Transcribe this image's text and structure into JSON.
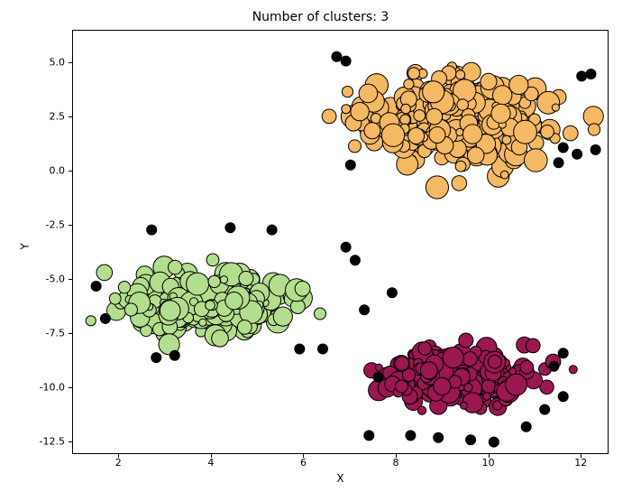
{
  "chart_data": {
    "type": "scatter",
    "title": "Number of clusters: 3",
    "xlabel": "X",
    "ylabel": "Y",
    "xlim": [
      1.0,
      12.6
    ],
    "ylim": [
      -13.1,
      6.5
    ],
    "xticks": [
      2,
      4,
      6,
      8,
      10,
      12
    ],
    "yticks": [
      -12.5,
      -10.0,
      -7.5,
      -5.0,
      -2.5,
      0.0,
      2.5,
      5.0
    ],
    "n_clusters": 3,
    "clusters": [
      {
        "name": "cluster-0",
        "color": "#b3de8e",
        "edge": "#000000",
        "center": [
          4.0,
          -6.0
        ],
        "spread": [
          1.7,
          1.3
        ],
        "n": 260,
        "size_range": [
          4,
          13
        ]
      },
      {
        "name": "cluster-1",
        "color": "#f5b863",
        "edge": "#000000",
        "center": [
          9.3,
          2.3
        ],
        "spread": [
          2.0,
          2.0
        ],
        "n": 340,
        "size_range": [
          4,
          13
        ]
      },
      {
        "name": "cluster-2",
        "color": "#9a1750",
        "edge": "#000000",
        "center": [
          9.3,
          -9.6
        ],
        "spread": [
          1.6,
          1.2
        ],
        "n": 260,
        "size_range": [
          4,
          12
        ]
      }
    ],
    "outliers": {
      "color": "#000000",
      "radius": 6,
      "points": [
        [
          1.5,
          -5.3
        ],
        [
          1.7,
          -6.8
        ],
        [
          2.7,
          -2.7
        ],
        [
          2.8,
          -8.6
        ],
        [
          3.2,
          -8.5
        ],
        [
          4.4,
          -2.6
        ],
        [
          5.3,
          -2.7
        ],
        [
          5.9,
          -8.2
        ],
        [
          6.4,
          -8.2
        ],
        [
          6.7,
          5.3
        ],
        [
          6.9,
          5.1
        ],
        [
          6.9,
          -3.5
        ],
        [
          7.0,
          0.3
        ],
        [
          7.1,
          -4.1
        ],
        [
          7.3,
          -6.4
        ],
        [
          7.6,
          -9.5
        ],
        [
          7.9,
          -5.6
        ],
        [
          7.4,
          -12.2
        ],
        [
          8.3,
          -12.2
        ],
        [
          8.9,
          -12.3
        ],
        [
          9.6,
          -12.4
        ],
        [
          10.1,
          -12.5
        ],
        [
          10.8,
          -11.8
        ],
        [
          11.2,
          -11.0
        ],
        [
          11.4,
          -9.0
        ],
        [
          11.6,
          -8.4
        ],
        [
          11.6,
          -10.4
        ],
        [
          11.5,
          0.4
        ],
        [
          11.6,
          1.1
        ],
        [
          11.9,
          0.8
        ],
        [
          12.0,
          4.4
        ],
        [
          12.2,
          4.5
        ],
        [
          12.3,
          1.0
        ]
      ]
    }
  }
}
